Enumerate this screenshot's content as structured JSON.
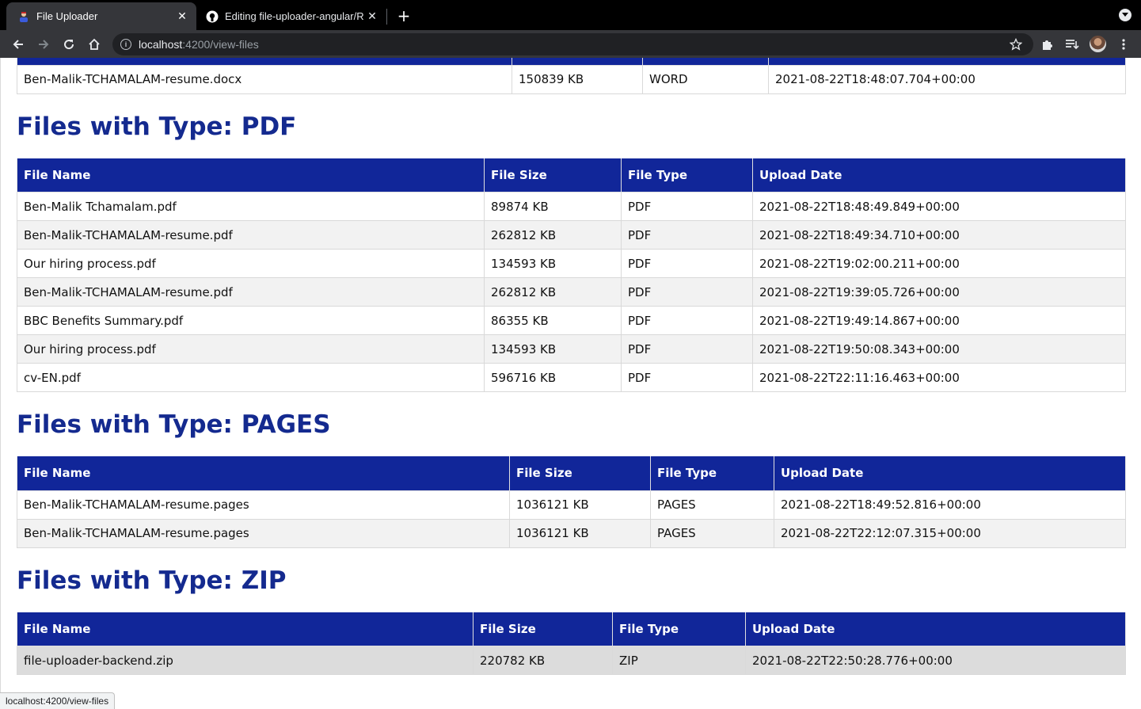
{
  "browser": {
    "tabs": [
      {
        "title": "File Uploader",
        "active": true
      },
      {
        "title": "Editing file-uploader-angular/R",
        "active": false
      }
    ],
    "url_host": "localhost",
    "url_path": ":4200/view-files",
    "status_url": "localhost:4200/view-files"
  },
  "columns": [
    "File Name",
    "File Size",
    "File Type",
    "Upload Date"
  ],
  "top_table": {
    "rows": [
      {
        "name": "Ben-Malik-TCHAMALAM-resume.docx",
        "size": "150839 KB",
        "type": "WORD",
        "date": "2021-08-22T18:48:07.704+00:00"
      }
    ]
  },
  "sections": [
    {
      "heading": "Files with Type: PDF",
      "rows": [
        {
          "name": "Ben-Malik Tchamalam.pdf",
          "size": "89874 KB",
          "type": "PDF",
          "date": "2021-08-22T18:48:49.849+00:00"
        },
        {
          "name": "Ben-Malik-TCHAMALAM-resume.pdf",
          "size": "262812 KB",
          "type": "PDF",
          "date": "2021-08-22T18:49:34.710+00:00"
        },
        {
          "name": "Our hiring process.pdf",
          "size": "134593 KB",
          "type": "PDF",
          "date": "2021-08-22T19:02:00.211+00:00"
        },
        {
          "name": "Ben-Malik-TCHAMALAM-resume.pdf",
          "size": "262812 KB",
          "type": "PDF",
          "date": "2021-08-22T19:39:05.726+00:00"
        },
        {
          "name": "BBC Benefits Summary.pdf",
          "size": "86355 KB",
          "type": "PDF",
          "date": "2021-08-22T19:49:14.867+00:00"
        },
        {
          "name": "Our hiring process.pdf",
          "size": "134593 KB",
          "type": "PDF",
          "date": "2021-08-22T19:50:08.343+00:00"
        },
        {
          "name": "cv-EN.pdf",
          "size": "596716 KB",
          "type": "PDF",
          "date": "2021-08-22T22:11:16.463+00:00"
        }
      ]
    },
    {
      "heading": "Files with Type: PAGES",
      "rows": [
        {
          "name": "Ben-Malik-TCHAMALAM-resume.pages",
          "size": "1036121 KB",
          "type": "PAGES",
          "date": "2021-08-22T18:49:52.816+00:00"
        },
        {
          "name": "Ben-Malik-TCHAMALAM-resume.pages",
          "size": "1036121 KB",
          "type": "PAGES",
          "date": "2021-08-22T22:12:07.315+00:00"
        }
      ]
    },
    {
      "heading": "Files with Type: ZIP",
      "rows": [
        {
          "name": "file-uploader-backend.zip",
          "size": "220782 KB",
          "type": "ZIP",
          "date": "2021-08-22T22:50:28.776+00:00"
        }
      ]
    }
  ],
  "colors": {
    "header_bg": "#112699",
    "heading": "#142a8f"
  }
}
